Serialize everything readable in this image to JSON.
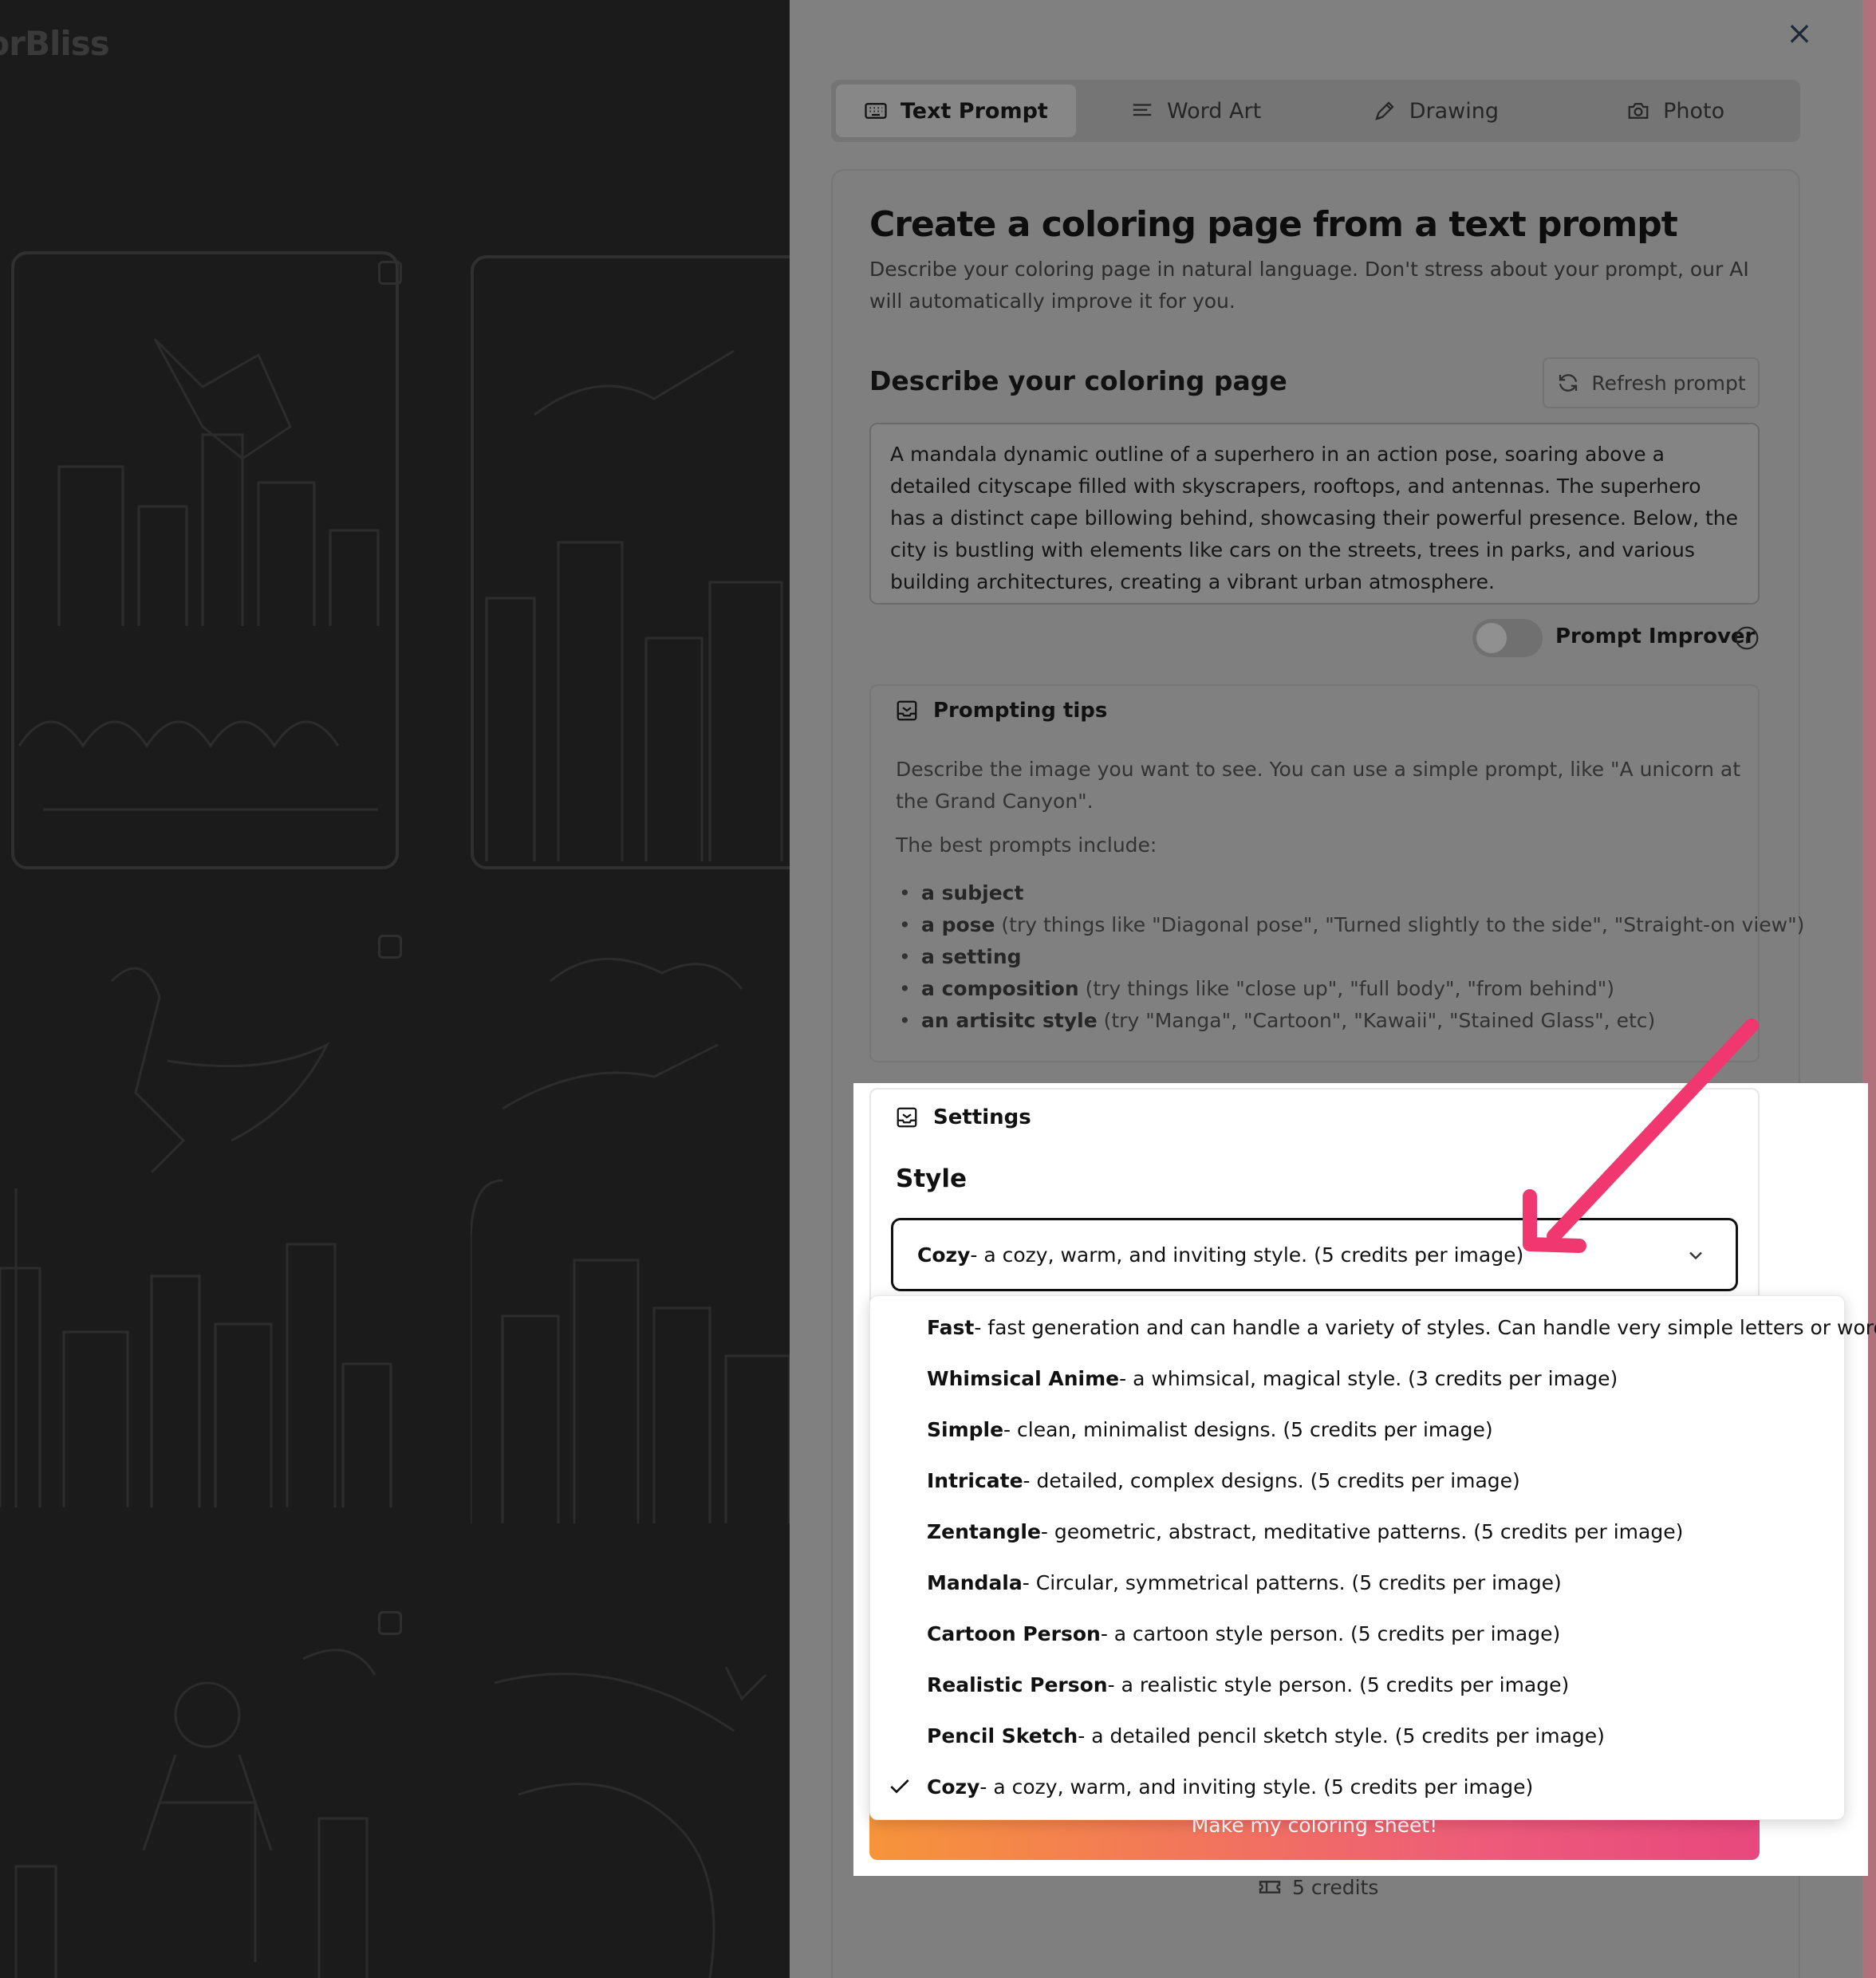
{
  "brand": "lorBliss",
  "close": "×",
  "tabs": [
    {
      "label": "Text Prompt",
      "icon": "keyboard-icon",
      "active": true
    },
    {
      "label": "Word Art",
      "icon": "text-lines-icon",
      "active": false
    },
    {
      "label": "Drawing",
      "icon": "pencil-icon",
      "active": false
    },
    {
      "label": "Photo",
      "icon": "camera-icon",
      "active": false
    }
  ],
  "card": {
    "title": "Create a coloring page from a text prompt",
    "subtitle": "Describe your coloring page in natural language. Don't stress about your prompt, our AI will automatically improve it for you."
  },
  "prompt": {
    "heading": "Describe your coloring page",
    "refresh_label": "Refresh prompt",
    "value": "A mandala dynamic outline of a superhero in an action pose, soaring above a detailed cityscape filled with skyscrapers, rooftops, and antennas. The superhero has a distinct cape billowing behind, showcasing their powerful presence. Below, the city is bustling with elements like cars on the streets, trees in parks, and various building architectures, creating a vibrant urban atmosphere.",
    "improver_label": "Prompt Improver",
    "improver_on": false
  },
  "tips": {
    "heading": "Prompting tips",
    "intro": "Describe the image you want to see. You can use a simple prompt, like \"A unicorn at the Grand Canyon\".",
    "best": "The best prompts include:",
    "items": [
      {
        "bold": "a subject",
        "rest": ""
      },
      {
        "bold": "a pose",
        "rest": " (try things like \"Diagonal pose\", \"Turned slightly to the side\", \"Straight-on view\")"
      },
      {
        "bold": "a setting",
        "rest": ""
      },
      {
        "bold": "a composition",
        "rest": " (try things like \"close up\", \"full body\", \"from behind\")"
      },
      {
        "bold": "an artisitc style",
        "rest": " (try \"Manga\", \"Cartoon\", \"Kawaii\", \"Stained Glass\", etc)"
      }
    ]
  },
  "settings": {
    "heading": "Settings",
    "style_label": "Style",
    "selected": {
      "name": "Cozy",
      "desc": " - a cozy, warm, and inviting style. (5 credits per image)"
    },
    "options": [
      {
        "name": "Fast",
        "desc": " - fast generation and can handle a variety of styles. Can handle very simple letters or words."
      },
      {
        "name": "Whimsical Anime",
        "desc": " - a whimsical, magical style. (3 credits per image)"
      },
      {
        "name": "Simple",
        "desc": " - clean, minimalist designs. (5 credits per image)"
      },
      {
        "name": "Intricate",
        "desc": " - detailed, complex designs. (5 credits per image)"
      },
      {
        "name": "Zentangle",
        "desc": " - geometric, abstract, meditative patterns. (5 credits per image)"
      },
      {
        "name": "Mandala",
        "desc": " - Circular, symmetrical patterns. (5 credits per image)"
      },
      {
        "name": "Cartoon Person",
        "desc": " - a cartoon style person. (5 credits per image)"
      },
      {
        "name": "Realistic Person",
        "desc": " - a realistic style person. (5 credits per image)"
      },
      {
        "name": "Pencil Sketch",
        "desc": " - a detailed pencil sketch style. (5 credits per image)"
      },
      {
        "name": "Cozy",
        "desc": " - a cozy, warm, and inviting style. (5 credits per image)",
        "checked": true
      }
    ]
  },
  "cta_label": "Make my coloring sheet!",
  "credits_label": "5 credits",
  "colors": {
    "accent_start": "#f7943a",
    "accent_end": "#e8487e",
    "annotation_arrow": "#f0376f"
  }
}
